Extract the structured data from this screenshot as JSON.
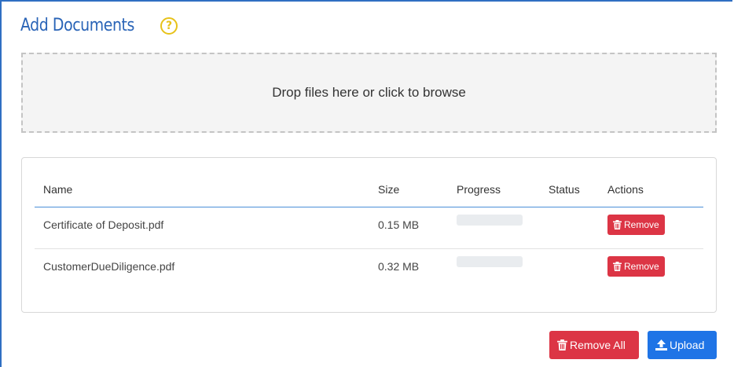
{
  "header": {
    "title": "Add Documents",
    "help_icon": "?"
  },
  "dropzone": {
    "text": "Drop files here or click to browse"
  },
  "table": {
    "columns": [
      "Name",
      "Size",
      "Progress",
      "Status",
      "Actions"
    ],
    "rows": [
      {
        "name": "Certificate of Deposit.pdf",
        "size": "0.15 MB",
        "progress": 0,
        "status": "",
        "action_label": "Remove"
      },
      {
        "name": "CustomerDueDiligence.pdf",
        "size": "0.32 MB",
        "progress": 0,
        "status": "",
        "action_label": "Remove"
      }
    ]
  },
  "footer": {
    "remove_all_label": "Remove All",
    "upload_label": "Upload"
  },
  "icons": {
    "help": "question-circle-icon",
    "row_remove": "trash-icon",
    "remove_all": "trash-icon",
    "upload": "upload-icon"
  },
  "colors": {
    "title": "#2a64b7",
    "help": "#e7c21a",
    "danger": "#dc3545",
    "primary": "#1f74e6",
    "header_rule": "#4a8fd8"
  }
}
